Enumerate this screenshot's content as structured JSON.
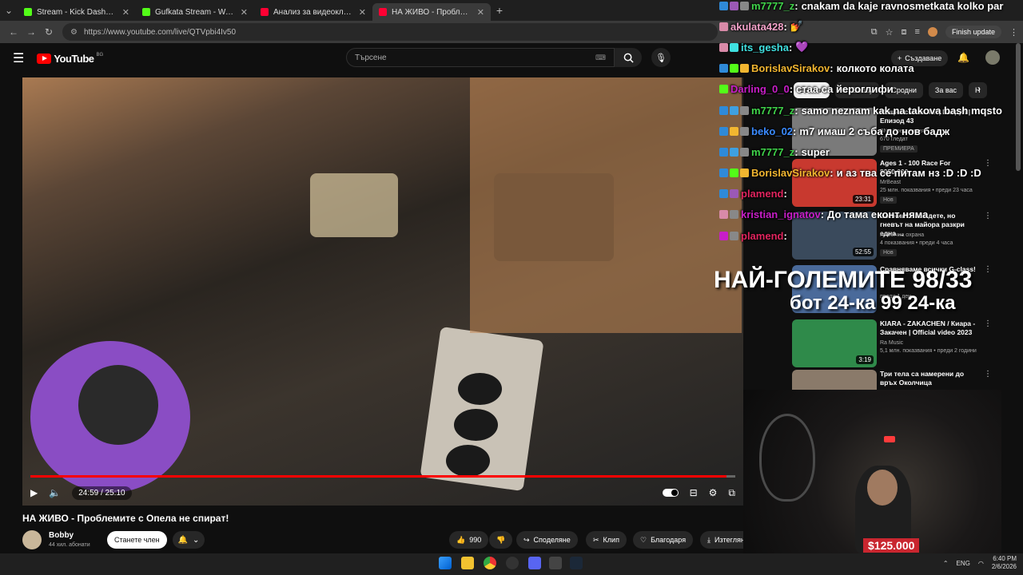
{
  "browser": {
    "tabs": [
      {
        "title": "Stream - Kick Dashboard",
        "color": "#53fc18",
        "active": false
      },
      {
        "title": "Gufkata Stream - Watch Live o",
        "color": "#53fc18",
        "active": false
      },
      {
        "title": "Анализ за видеоклипа - YouTu",
        "color": "#ff0033",
        "active": false
      },
      {
        "title": "НА ЖИВО - Проблемите с Опе",
        "color": "#ff0033",
        "active": true
      }
    ],
    "url": "https://www.youtube.com/live/QTVpbi4Iv50",
    "finish_update": "Finish update"
  },
  "youtube": {
    "logo_text": "YouTube",
    "country_code": "BG",
    "search_placeholder": "Търсене",
    "create_label": "Създаване"
  },
  "player": {
    "time": "24:59 / 25:10",
    "progress": 0.988
  },
  "video": {
    "title": "НА ЖИВО - Проблемите с Опела не спират!",
    "channel": "Bobby",
    "subscribers": "44 хил. абонати",
    "join_label": "Станете член",
    "likes": "990",
    "share_label": "Споделяне",
    "clip_label": "Клип",
    "thanks_label": "Благодаря",
    "download_label": "Изтегляне",
    "more": "•••"
  },
  "chips": [
    "Всички",
    "От Bobby",
    "Сродни",
    "За вас",
    "Н"
  ],
  "recommendations": [
    {
      "title": "Нощна смяна 4 ? | Патрул | Епизод 43",
      "channel": "BNT Предавания",
      "meta": "670 гледат",
      "badge": "ПРЕМИЕРА",
      "duration": "",
      "thumb": "#7a7a7a"
    },
    {
      "title": "Ages 1 - 100 Race For $250,000",
      "channel": "MrBeast",
      "meta": "25 млн. показвания • преди 23 часа",
      "badge": "Нов",
      "duration": "23:31",
      "thumb": "#c8392f"
    },
    {
      "title": "Войник спаси дете, но гневът на майора разкри една ...",
      "channel": "Гранична охрана",
      "meta": "4 показвания • преди 4 часа",
      "badge": "Нов",
      "duration": "52:55",
      "thumb": "#3a4a5c"
    },
    {
      "title": "Сравняваме всички G-class!",
      "channel": "",
      "meta": "преди 1 ден",
      "badge": "",
      "duration": "",
      "thumb": "#4a6a9a"
    },
    {
      "title": "KIARA - ZAKACHEN / Киара - Закачен | Official video 2023",
      "channel": "Ra Music",
      "meta": "5,1 млн. показвания • преди 2 години",
      "badge": "",
      "duration": "3:19",
      "thumb": "#2f8a4a"
    },
    {
      "title": "Три тела са намерени до връх Околчица",
      "channel": "",
      "meta": "",
      "badge": "",
      "duration": "",
      "thumb": "#8a7a6a"
    }
  ],
  "chat": [
    {
      "user": "m7777_z",
      "color": "#3fd44a",
      "text": "cnakam da kaje ravnosmetkata kolko par",
      "badges": [
        "#2f8ad8",
        "#9b59b6",
        "#888888"
      ]
    },
    {
      "user": "akulata428",
      "color": "#f3a2c9",
      "text": "💅",
      "badges": [
        "#d88aa8"
      ]
    },
    {
      "user": "its_gesha",
      "color": "#3fe0e0",
      "text": "💜",
      "badges": [
        "#d88aa8",
        "#3fe0e0"
      ]
    },
    {
      "user": "BorislavSirakov",
      "color": "#f2b630",
      "text": "колкото колата",
      "badges": [
        "#2f8ad8",
        "#53fc18",
        "#f2b630"
      ]
    },
    {
      "user": "Darling_0_0",
      "color": "#c81ec8",
      "text": "стаа са йероглифи",
      "badges": [
        "#53fc18"
      ]
    },
    {
      "user": "m7777_z",
      "color": "#3fd44a",
      "text": "samo neznam kak na takova bash mqsto",
      "badges": [
        "#2f8ad8",
        "#3fa0e0",
        "#888888"
      ]
    },
    {
      "user": "beko_02",
      "color": "#3a8aff",
      "text": "m7 имаш 2 съба до нов бадж",
      "badges": [
        "#2f8ad8",
        "#f2b630",
        "#888888"
      ]
    },
    {
      "user": "m7777_z",
      "color": "#3fd44a",
      "text": "super",
      "badges": [
        "#2f8ad8",
        "#3fa0e0",
        "#888888"
      ]
    },
    {
      "user": "BorislavSirakov",
      "color": "#f2b630",
      "text": "и аз тва се питам нз :D :D :D",
      "badges": [
        "#2f8ad8",
        "#53fc18",
        "#f2b630"
      ]
    },
    {
      "user": "plamend",
      "color": "#e0245e",
      "text": "",
      "badges": [
        "#2f8ad8",
        "#9b59b6"
      ]
    },
    {
      "user": "kristian_ignatov",
      "color": "#c81ec8",
      "text": "До тама еконт няма",
      "badges": [
        "#d88aa8",
        "#888888"
      ]
    },
    {
      "user": "plamend",
      "color": "#e0245e",
      "text": "",
      "badges": [
        "#c81ec8",
        "#888888"
      ]
    }
  ],
  "overlay": {
    "line1": "НАЙ-ГОЛЕМИТЕ 98/33",
    "line2": "бот 24-ка 99 24-ка"
  },
  "webcam": {
    "donation": "$125.000"
  },
  "taskbar": {
    "lang": "ENG",
    "time": "6:40 PM",
    "date": "2/6/2026"
  }
}
